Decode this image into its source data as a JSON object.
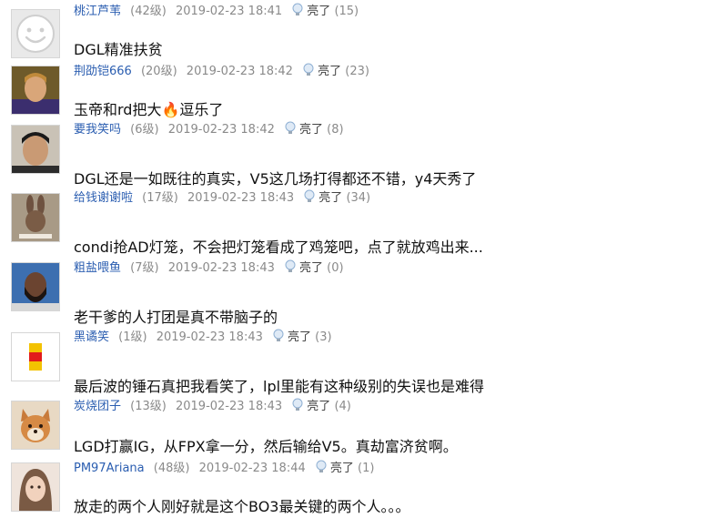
{
  "comments": [
    {
      "user": "桃江芦苇",
      "level": "(42级)",
      "time": "2019-02-23 18:41",
      "like_label": "亮了",
      "like_count": "(15)",
      "content": "DGL精准扶贫",
      "avatar": "default-smiley"
    },
    {
      "user": "荆劭铠666",
      "level": "(20级)",
      "time": "2019-02-23 18:42",
      "like_label": "亮了",
      "like_count": "(23)",
      "content": "玉帝和rd把大🔥逗乐了",
      "avatar": "footballer-photo"
    },
    {
      "user": "要我笑吗",
      "level": "(6级)",
      "time": "2019-02-23 18:42",
      "like_label": "亮了",
      "like_count": "(8)",
      "content": "DGL还是一如既往的真实，V5这几场打得都还不错，y4天秀了",
      "avatar": "man-photo"
    },
    {
      "user": "给钱谢谢啦",
      "level": "(17级)",
      "time": "2019-02-23 18:43",
      "like_label": "亮了",
      "like_count": "(34)",
      "content": "condi抢AD灯笼，不会把灯笼看成了鸡笼吧，点了就放鸡出来...",
      "avatar": "rabbit-photo"
    },
    {
      "user": "粗盐喂鱼",
      "level": "(7级)",
      "time": "2019-02-23 18:43",
      "like_label": "亮了",
      "like_count": "(0)",
      "content": "老干爹的人打团是真不带脑子的",
      "avatar": "bearded-man-photo"
    },
    {
      "user": "黑谲笑",
      "level": "(1级)",
      "time": "2019-02-23 18:43",
      "like_label": "亮了",
      "like_count": "(3)",
      "content": "最后波的锤石真把我看笑了，lpl里能有这种级别的失误也是难得",
      "avatar": "yellow-red-flag"
    },
    {
      "user": "炭烧团子",
      "level": "(13级)",
      "time": "2019-02-23 18:43",
      "like_label": "亮了",
      "like_count": "(4)",
      "content": "LGD打赢IG，从FPX拿一分，然后输给V5。真劫富济贫啊。",
      "avatar": "shiba-dog-photo"
    },
    {
      "user": "PM97Ariana",
      "level": "(48级)",
      "time": "2019-02-23 18:44",
      "like_label": "亮了",
      "like_count": "(1)",
      "content": "放走的两个人刚好就是这个BO3最关键的两个人。。。",
      "avatar": "girl-photo"
    }
  ],
  "colors": {
    "username": "#2a5db0",
    "meta": "#8a8a8a",
    "content": "#111111",
    "border": "#d6d6d6"
  }
}
